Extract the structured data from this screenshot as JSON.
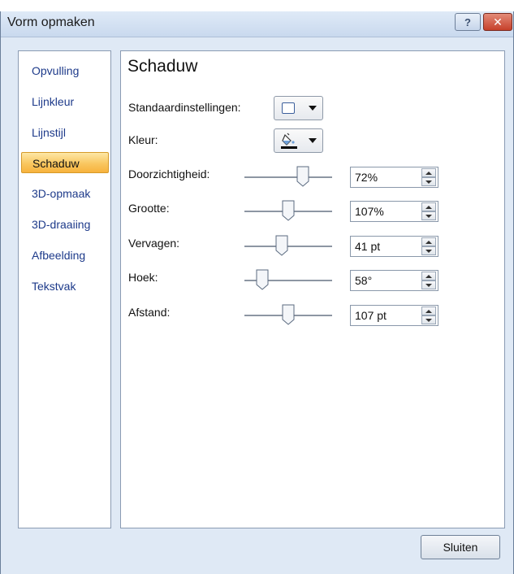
{
  "window": {
    "title": "Vorm opmaken",
    "help_label": "?",
    "close_label": "✕"
  },
  "sidebar": {
    "items": [
      {
        "label": "Opvulling"
      },
      {
        "label": "Lijnkleur"
      },
      {
        "label": "Lijnstijl"
      },
      {
        "label": "Schaduw",
        "active": true
      },
      {
        "label": "3D-opmaak"
      },
      {
        "label": "3D-draaiing"
      },
      {
        "label": "Afbeelding"
      },
      {
        "label": "Tekstvak"
      }
    ]
  },
  "panel": {
    "heading": "Schaduw",
    "preset": {
      "label": "Standaardinstellingen:",
      "icon": "shadow-preset-icon"
    },
    "color": {
      "label": "Kleur:",
      "icon": "paint-bucket-icon",
      "swatch": "#000000"
    },
    "sliders": [
      {
        "label": "Doorzichtigheid:",
        "value": "72%",
        "level": 0.72
      },
      {
        "label": "Grootte:",
        "value": "107%",
        "level": 0.5
      },
      {
        "label": "Vervagen:",
        "value": "41 pt",
        "level": 0.41
      },
      {
        "label": "Hoek:",
        "value": "58°",
        "level": 0.16
      },
      {
        "label": "Afstand:",
        "value": "107 pt",
        "level": 0.5
      }
    ]
  },
  "footer": {
    "close_button": "Sluiten"
  },
  "colors": {
    "accent_active": "#f9c760",
    "nav_text": "#1d3a8a",
    "window_bg": "#dfe9f5",
    "close_btn": "#c6402a"
  }
}
